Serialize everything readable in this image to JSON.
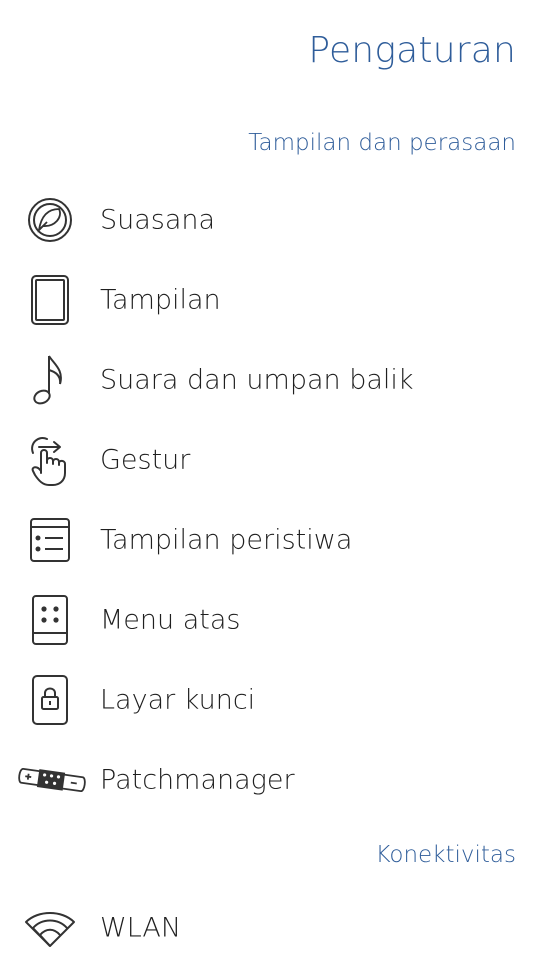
{
  "header": {
    "title": "Pengaturan"
  },
  "sections": [
    {
      "title": "Tampilan dan perasaan",
      "items": [
        {
          "label": "Suasana",
          "icon": "ambience-icon"
        },
        {
          "label": "Tampilan",
          "icon": "display-icon"
        },
        {
          "label": "Suara dan umpan balik",
          "icon": "music-note-icon"
        },
        {
          "label": "Gestur",
          "icon": "gesture-icon"
        },
        {
          "label": "Tampilan peristiwa",
          "icon": "events-list-icon"
        },
        {
          "label": "Menu atas",
          "icon": "top-menu-icon"
        },
        {
          "label": "Layar kunci",
          "icon": "lock-screen-icon"
        },
        {
          "label": "Patchmanager",
          "icon": "patch-icon"
        }
      ]
    },
    {
      "title": "Konektivitas",
      "items": [
        {
          "label": "WLAN",
          "icon": "wifi-icon"
        }
      ]
    }
  ],
  "colors": {
    "accent": "#2f5d9a",
    "text": "#1f1f1f",
    "icon": "#333333",
    "background": "#ffffff"
  }
}
